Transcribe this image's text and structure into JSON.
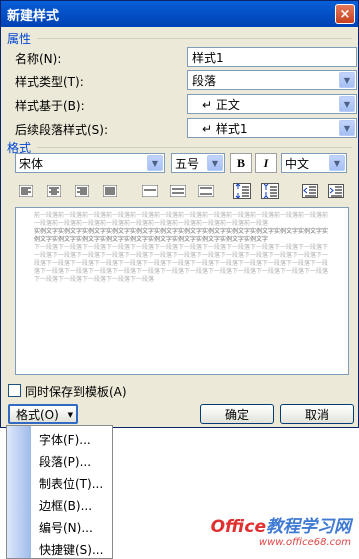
{
  "dialog": {
    "title": "新建样式",
    "close_label": "×"
  },
  "properties": {
    "section_title": "属性",
    "name": {
      "label": "名称(N):",
      "value": "样式1"
    },
    "type": {
      "label": "样式类型(T):",
      "value": "段落"
    },
    "based_on": {
      "label": "样式基于(B):",
      "value": "↵ 正文"
    },
    "next": {
      "label": "后续段落样式(S):",
      "value": "↵ 样式1"
    }
  },
  "format": {
    "section_title": "格式",
    "font": "宋体",
    "size": "五号",
    "bold": "B",
    "italic": "I",
    "script": "中文"
  },
  "preview": {
    "prev_text": "前一段落前一段落前一段落前一段落前一段落前一段落前一段落前一段落前一段落前一段落前一段落前一段落前一段落前一段落前一段落前一段落前一段落前一段落前一段落前一段落前一段落前一段落",
    "sample_text": "实例文字实例文字实例文字实例文字实例文字实例文字实例文字实例文字实例文字实例文字实例文字实例文字实例文字实例文字实例文字实例文字实例文字实例文字实例文字实例文字实例文字实例文字",
    "next_text": "下一段落下一段落下一段落下一段落下一段落下一段落下一段落下一段落下一段落下一段落下一段落下一段落下一段落下一段落下一段落下一段落下一段落下一段落下一段落下一段落下一段落下一段落下一段落下一段落下一段落下一段落下一段落下一段落下一段落下一段落下一段落下一段落下一段落下一段落下一段落下一段落下一段落下一段落下一段落下一段落下一段落下一段落下一段落下一段落下一段落下一段落下一段落下一段落下一段落下一段落下一段落下一段落下一段落下一段落"
  },
  "footer": {
    "add_to_template": "同时保存到模板(A)",
    "format_button": "格式(O)",
    "ok": "确定",
    "cancel": "取消"
  },
  "menu": {
    "items": [
      "字体(F)...",
      "段落(P)...",
      "制表位(T)...",
      "边框(B)...",
      "编号(N)...",
      "快捷键(S)..."
    ]
  },
  "watermark": {
    "main_a": "Office",
    "main_b": "教程学习网",
    "url": "www.office68.com"
  }
}
